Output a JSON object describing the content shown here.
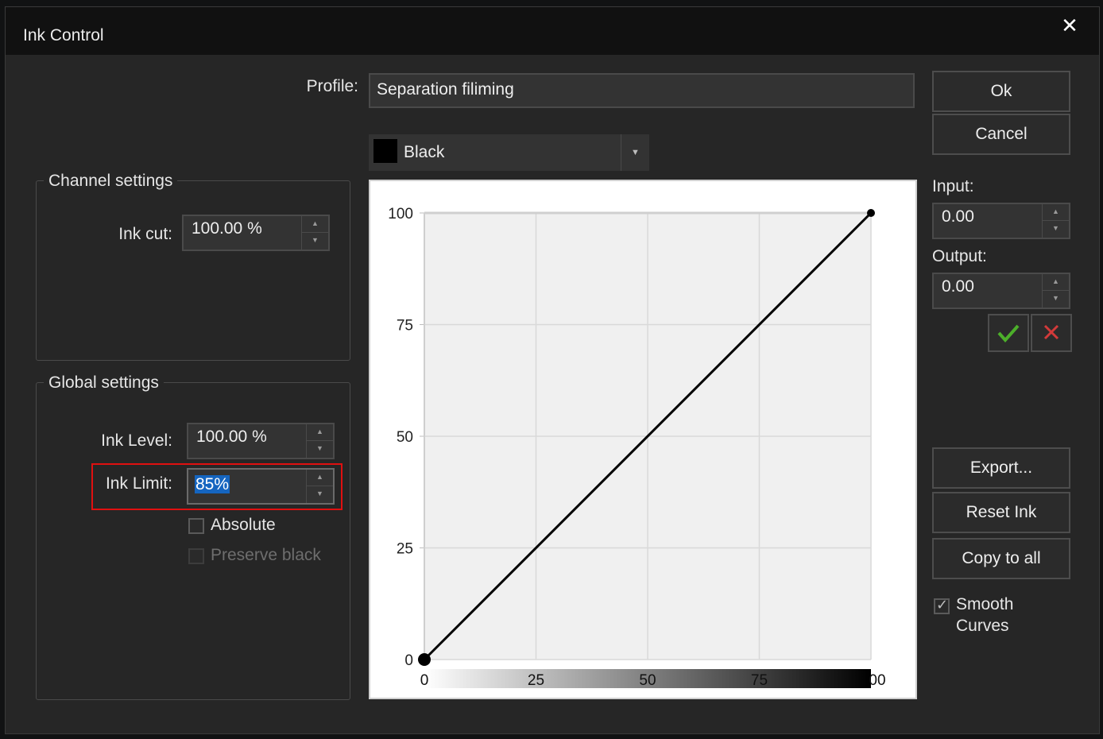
{
  "window": {
    "title": "Ink Control",
    "close_icon": "close-icon"
  },
  "profile": {
    "label": "Profile:",
    "value": "Separation filiming"
  },
  "channel_dropdown": {
    "value": "Black",
    "swatch_color": "#000000"
  },
  "buttons": {
    "ok": "Ok",
    "cancel": "Cancel",
    "export": "Export...",
    "reset_ink": "Reset Ink",
    "copy_to_all": "Copy to all"
  },
  "input": {
    "label": "Input:",
    "value": "0.00"
  },
  "output": {
    "label": "Output:",
    "value": "0.00"
  },
  "confirm_icons": {
    "apply": "check-icon",
    "discard": "cross-icon",
    "apply_color": "#4caf2a",
    "discard_color": "#d23a3a"
  },
  "channel_settings": {
    "title": "Channel settings",
    "ink_cut_label": "Ink cut:",
    "ink_cut_value": "100.00 %"
  },
  "global_settings": {
    "title": "Global settings",
    "ink_level_label": "Ink Level:",
    "ink_level_value": "100.00 %",
    "ink_limit_label": "Ink Limit:",
    "ink_limit_value": "85%",
    "absolute_label": "Absolute",
    "absolute_checked": false,
    "preserve_black_label": "Preserve black",
    "preserve_black_checked": false,
    "preserve_black_enabled": false
  },
  "smooth_curves": {
    "label_line1": "Smooth",
    "label_line2": "Curves",
    "checked": true
  },
  "highlight_color": "#e01010",
  "chart_data": {
    "type": "line",
    "title": "",
    "xlabel": "",
    "ylabel": "",
    "xlim": [
      0,
      100
    ],
    "ylim": [
      0,
      100
    ],
    "x_ticks": [
      "0",
      "25",
      "50",
      "75",
      "00"
    ],
    "y_ticks": [
      "0",
      "25",
      "50",
      "75",
      "100"
    ],
    "grid": true,
    "series": [
      {
        "x": [
          0,
          100
        ],
        "y": [
          0,
          100
        ],
        "color": "#000000"
      }
    ],
    "control_points": [
      {
        "x": 0,
        "y": 0
      },
      {
        "x": 100,
        "y": 100
      }
    ],
    "gradient_bar": {
      "from": "#ffffff",
      "to": "#000000"
    }
  }
}
